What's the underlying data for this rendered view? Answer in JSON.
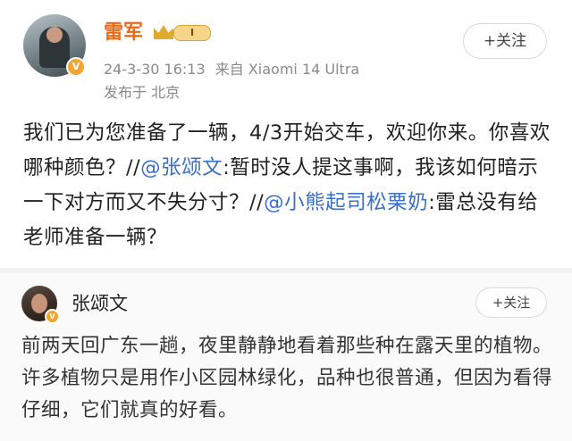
{
  "post": {
    "author_name": "雷军",
    "level_badge": "I",
    "follow_label": "+关注",
    "timestamp": "24-3-30 16:13",
    "source": "来自 Xiaomi 14 Ultra",
    "location": "发布于 北京",
    "text_part1": "我们已为您准备了一辆，4/3开始交车，欢迎你来。你喜欢哪种颜色？//",
    "mention1": "@张颂文",
    "text_part2": ":暂时没人提这事啊，我该如何暗示一下对方而又不失分寸？//",
    "mention2": "@小熊起司松栗奶",
    "text_part3": ":雷总没有给老师准备一辆？"
  },
  "comment": {
    "author_name": "张颂文",
    "follow_label": "+关注",
    "text": "前两天回广东一趟，夜里静静地看着那些种在露天里的植物。许多植物只是用作小区园林绿化，品种也很普通，但因为看得仔细，它们就真的好看。"
  },
  "colors": {
    "accent_orange": "#e86b1a",
    "link_blue": "#3a6fc7",
    "verify_gold": "#f2a531"
  }
}
